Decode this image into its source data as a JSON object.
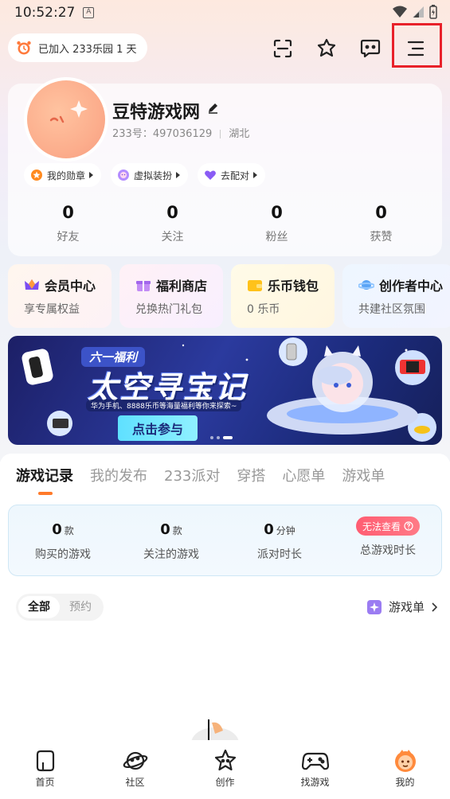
{
  "status_bar": {
    "time": "10:52:27",
    "badge": "A"
  },
  "header": {
    "joined_text": "已加入 233乐园 1 天",
    "icons": [
      "scan-icon",
      "puzzle-icon",
      "message-icon",
      "menu-icon"
    ]
  },
  "profile": {
    "name": "豆特游戏网",
    "id_text": "233号：497036129",
    "location": "湖北",
    "chips": [
      {
        "label": "我的勋章",
        "icon": "medal-icon"
      },
      {
        "label": "虚拟装扮",
        "icon": "avatar-dress-icon"
      },
      {
        "label": "去配对",
        "icon": "heart-match-icon"
      }
    ],
    "stats": [
      {
        "value": "0",
        "label": "好友"
      },
      {
        "value": "0",
        "label": "关注"
      },
      {
        "value": "0",
        "label": "粉丝"
      },
      {
        "value": "0",
        "label": "获赞"
      }
    ]
  },
  "quick_links": [
    {
      "title": "会员中心",
      "sub": "享专属权益",
      "icon": "crown-icon"
    },
    {
      "title": "福利商店",
      "sub": "兑换热门礼包",
      "icon": "gift-icon"
    },
    {
      "title": "乐币钱包",
      "sub": "0 乐币",
      "icon": "wallet-icon"
    },
    {
      "title": "创作者中心",
      "sub": "共建社区氛围",
      "icon": "planet-icon"
    }
  ],
  "banner": {
    "tag": "六一福利",
    "title": "太空寻宝记",
    "subtitle": "华为手机、8888乐币等海量福利等你来探索~",
    "cta": "点击参与"
  },
  "tabs": [
    "游戏记录",
    "我的发布",
    "233派对",
    "穿搭",
    "心愿单",
    "游戏单"
  ],
  "active_tab": 0,
  "game_stats": [
    {
      "value": "0",
      "unit": "款",
      "label": "购买的游戏"
    },
    {
      "value": "0",
      "unit": "款",
      "label": "关注的游戏"
    },
    {
      "value": "0",
      "unit": "分钟",
      "label": "派对时长"
    }
  ],
  "total_time": {
    "badge": "无法查看",
    "label": "总游戏时长"
  },
  "filters": [
    "全部",
    "预约"
  ],
  "gamelist_link": "游戏单",
  "bottom_nav": [
    {
      "label": "首页",
      "icon": "home-icon"
    },
    {
      "label": "社区",
      "icon": "community-planet-icon"
    },
    {
      "label": "创作",
      "icon": "create-star-icon"
    },
    {
      "label": "找游戏",
      "icon": "gamepad-icon"
    },
    {
      "label": "我的",
      "icon": "profile-mascot-icon"
    }
  ],
  "colors": {
    "accent": "#ff7a2a",
    "highlight": "#e8212a",
    "badge": "#ff5d72"
  }
}
